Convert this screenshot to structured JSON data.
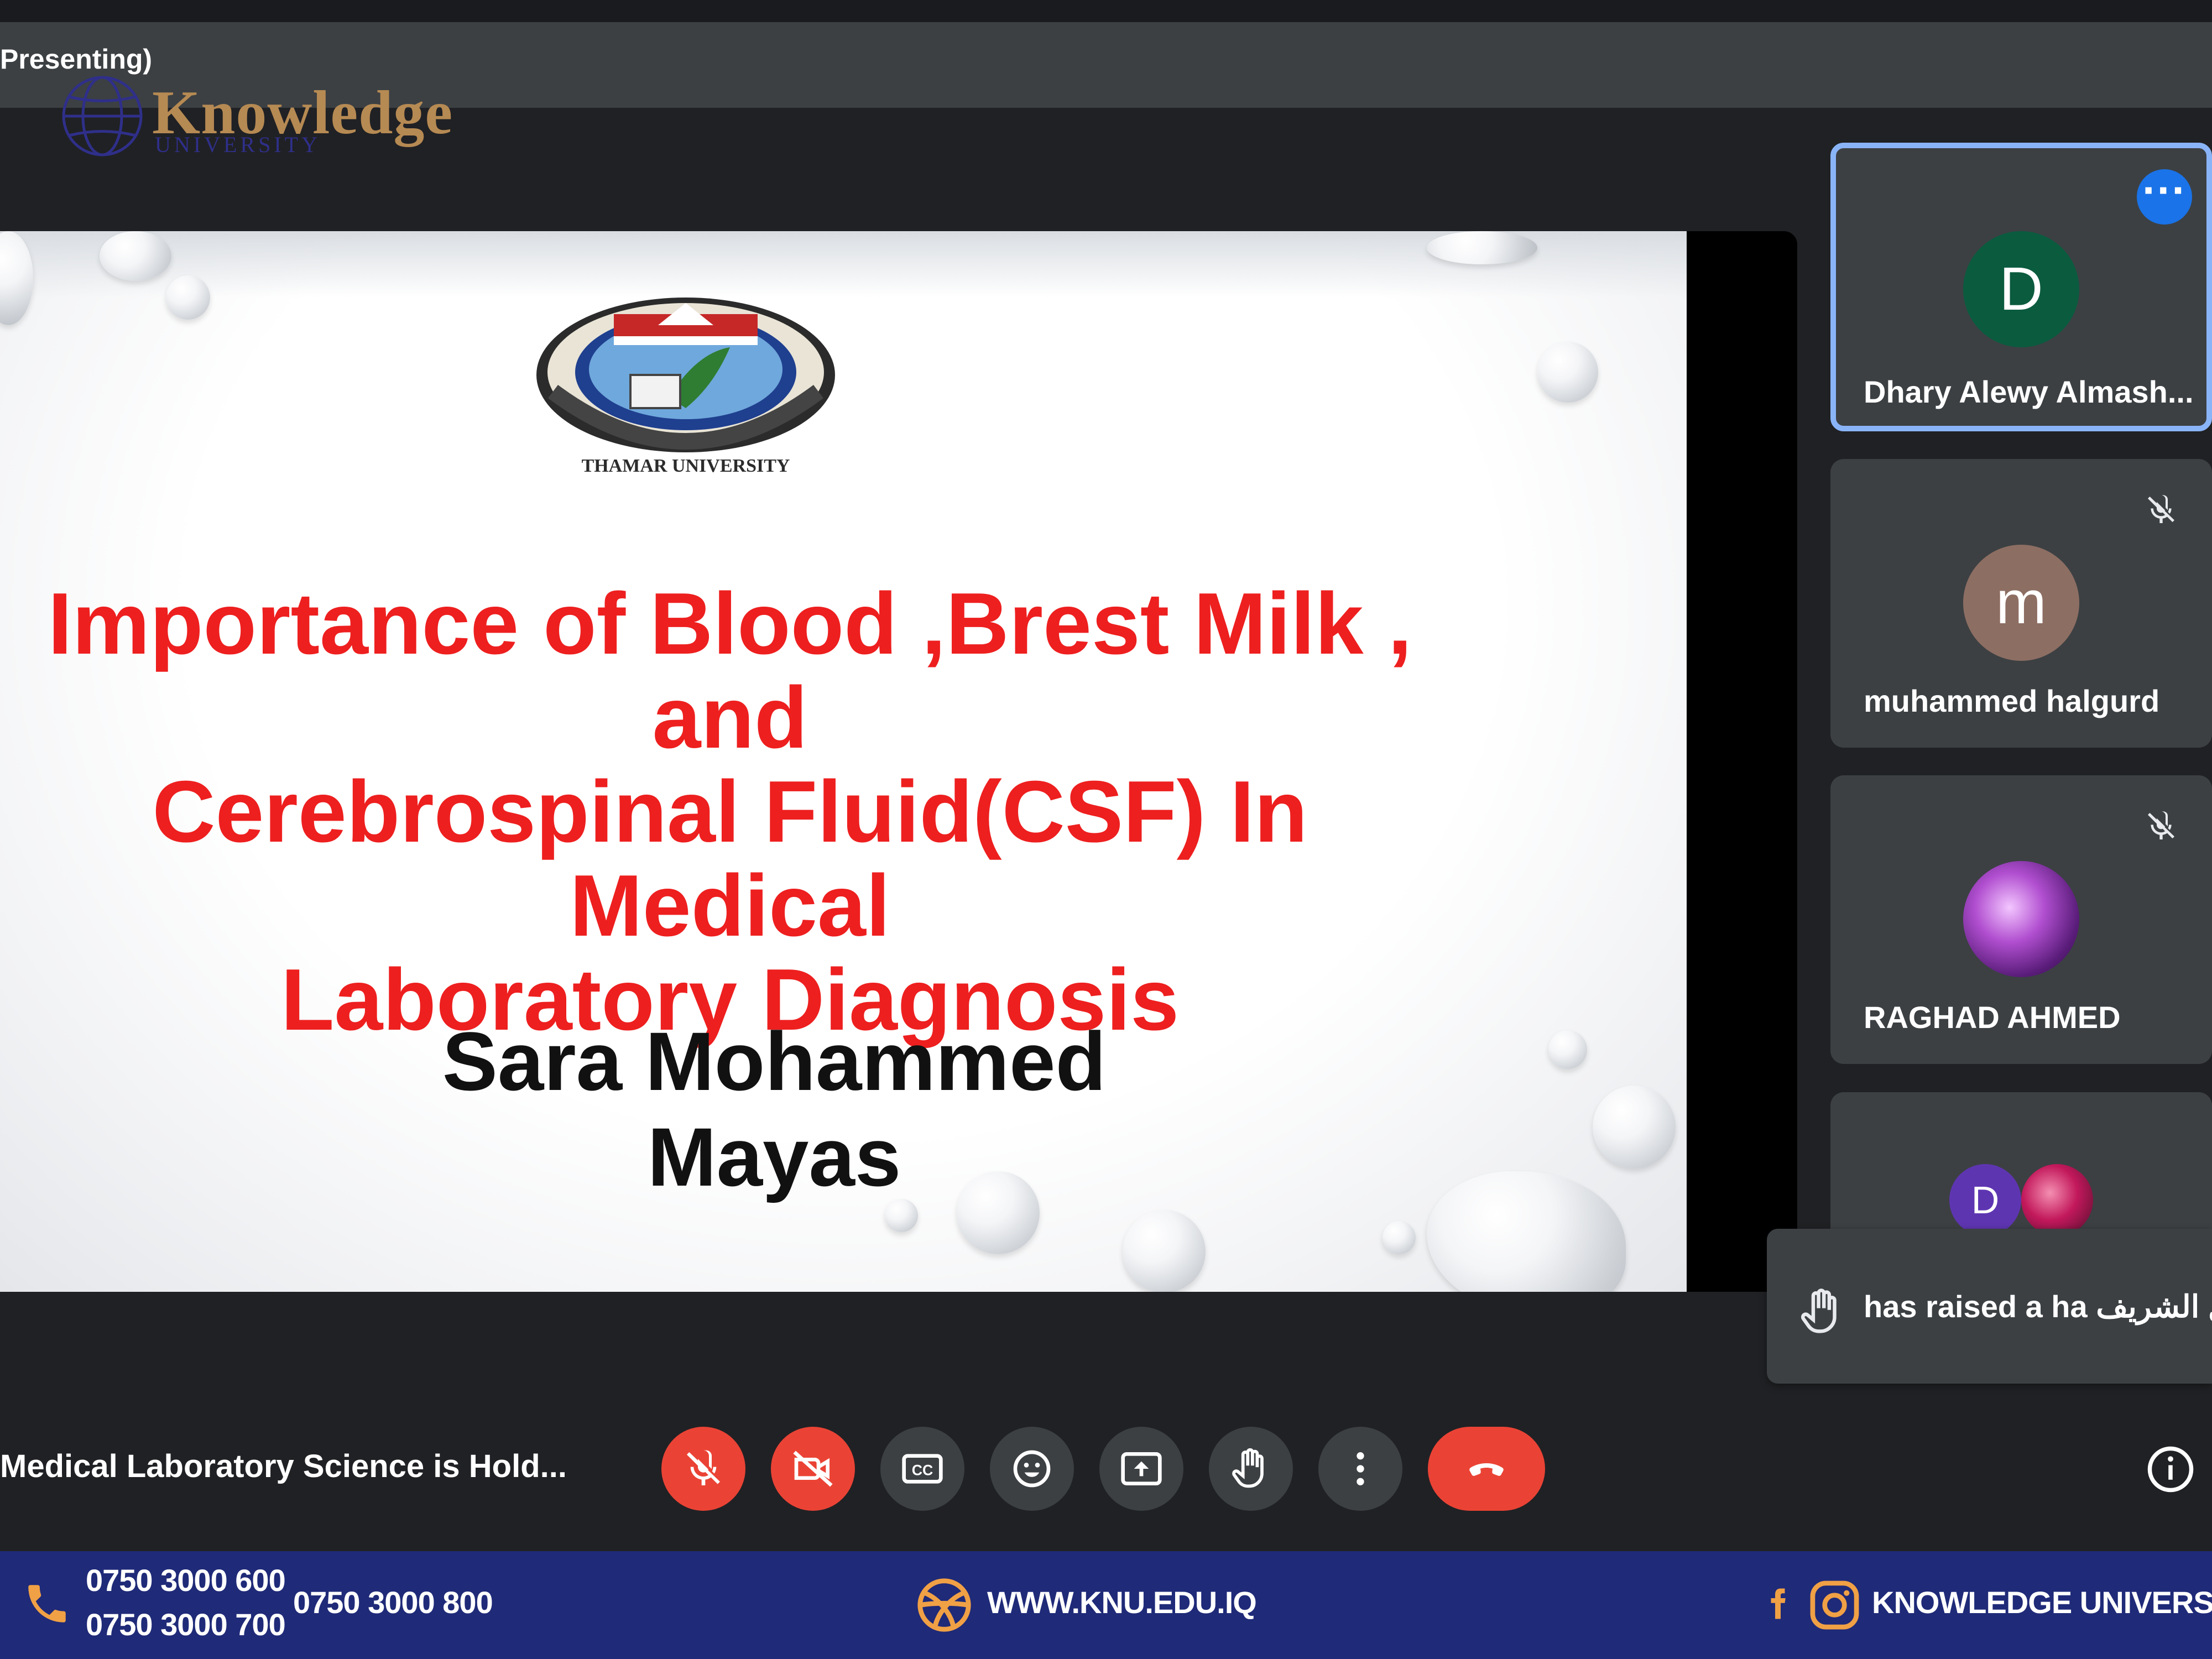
{
  "presenting_label": "Presenting)",
  "brand": {
    "name": "Knowledge",
    "sub": "UNIVERSITY"
  },
  "slide": {
    "title_lines": [
      "Importance of Blood ,Brest Milk , and",
      "Cerebrospinal Fluid(CSF) In Medical",
      "Laboratory Diagnosis"
    ],
    "author": "Sara Mohammed Mayas",
    "emblem_text": "THAMAR UNIVERSITY"
  },
  "participants": [
    {
      "initial": "D",
      "name": "Dhary Alewy Almash...",
      "avatar_color": "#0b5b3f",
      "muted": false,
      "active": true
    },
    {
      "initial": "m",
      "name": "muhammed halgurd",
      "avatar_color": "#8d6e63",
      "muted": true,
      "active": false
    },
    {
      "initial": "",
      "name": "RAGHAD AHMED",
      "avatar_color": "#7b3f8f",
      "muted": true,
      "active": false
    },
    {
      "initial": "D",
      "name": "",
      "avatar_color": "#5e35b1",
      "muted": false,
      "active": false
    }
  ],
  "toast": {
    "text": "اجلال الشريف has raised a ha",
    "icon": "hand-icon"
  },
  "meeting_title": "Medical Laboratory Science is Hold...",
  "controls": [
    "mic-off-icon",
    "camera-off-icon",
    "captions-icon",
    "emoji-icon",
    "present-icon",
    "raise-hand-icon",
    "more-vert-icon",
    "end-call-icon"
  ],
  "footer": {
    "phone1": "0750 3000 600",
    "phone2": "0750 3000 700",
    "phone3": "0750 3000 800",
    "website": "WWW.KNU.EDU.IQ",
    "social": "KNOWLEDGE UNIVERSITY"
  },
  "colors": {
    "accent_blue": "#1a73e8",
    "danger_red": "#ea4335",
    "footer_blue": "#1f2a78",
    "slide_title_red": "#ee1f1f"
  }
}
